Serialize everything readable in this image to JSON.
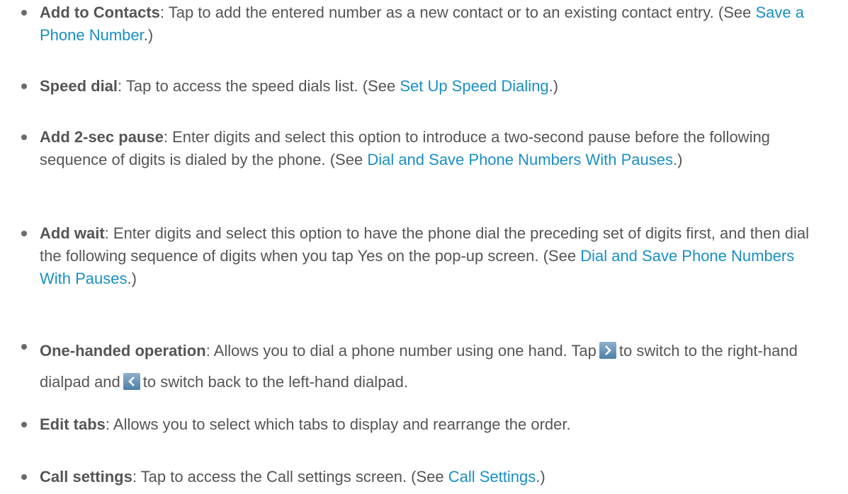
{
  "items": [
    {
      "term": "Add to Contacts",
      "text": ": Tap to add the entered number as a new contact or to an existing contact entry. (See ",
      "link": "Save a Phone Number",
      "tail": ".)"
    },
    {
      "term": "Speed dial",
      "text": ": Tap to access the speed dials list. (See ",
      "link": "Set Up Speed Dialing",
      "tail": ".)"
    },
    {
      "term": "Add 2-sec pause",
      "text": ": Enter digits and select this option to introduce a two-second pause before the following sequence of digits is dialed by the phone. (See ",
      "link": "Dial and Save Phone Numbers With Pauses",
      "tail": ".)"
    },
    {
      "term": "Add wait",
      "text": ": Enter digits and select this option to have the phone dial the preceding set of digits first, and then dial the following sequence of digits when you tap Yes on the pop-up screen. (See ",
      "link": "Dial and Save Phone Numbers With Pauses",
      "tail": ".)"
    },
    {
      "term": "One-handed operation",
      "text_a": ": Allows you to dial a phone number using one hand. Tap",
      "text_b": "to switch to the right-hand dialpad and",
      "text_c": "to switch back to the left-hand dialpad.",
      "icons": [
        "chevron-right-icon",
        "chevron-left-icon"
      ]
    },
    {
      "term": "Edit tabs",
      "text": ": Allows you to select which tabs to display and rearrange the order."
    },
    {
      "term": "Call settings",
      "text": ": Tap to access the Call settings screen. (See ",
      "link": "Call Settings",
      "tail": ".)"
    }
  ],
  "colors": {
    "text": "#555555",
    "link": "#1a8fc4",
    "bullet": "#6a6a6a"
  }
}
